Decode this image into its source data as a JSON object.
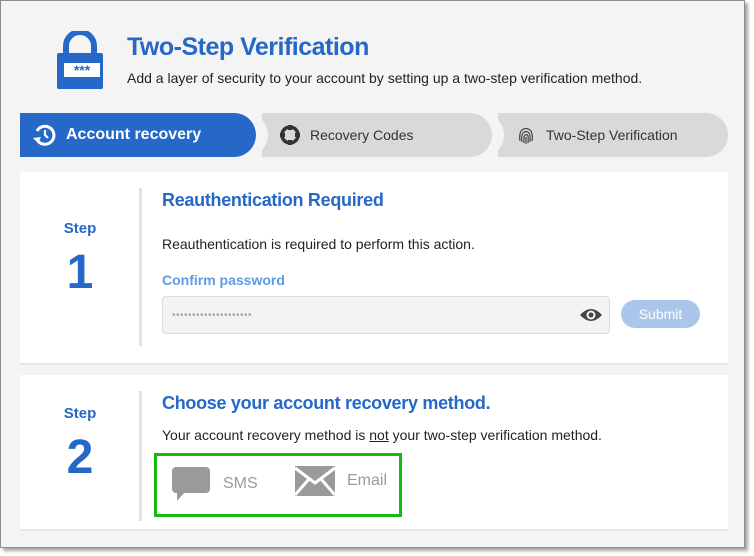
{
  "header": {
    "title": "Two-Step Verification",
    "subtitle": "Add a layer of security to your account by setting up a two-step verification method.",
    "icon": "lock-password-icon"
  },
  "tabs": [
    {
      "label": "Account recovery",
      "icon": "history-icon",
      "active": true
    },
    {
      "label": "Recovery Codes",
      "icon": "lifebuoy-icon",
      "active": false
    },
    {
      "label": "Two-Step Verification",
      "icon": "fingerprint-icon",
      "active": false
    }
  ],
  "steps": [
    {
      "step_label": "Step",
      "number": "1",
      "title": "Reauthentication Required",
      "text": "Reauthentication is required to perform this action.",
      "field_label": "Confirm password",
      "password_value": "••••••••••••••••••••",
      "submit_label": "Submit"
    },
    {
      "step_label": "Step",
      "number": "2",
      "title": "Choose your account recovery method.",
      "text_before": "Your account recovery method is ",
      "text_emph": "not",
      "text_after": " your two-step verification method.",
      "methods": [
        {
          "label": "SMS",
          "icon": "chat-bubble-icon"
        },
        {
          "label": "Email",
          "icon": "envelope-icon"
        }
      ]
    }
  ],
  "colors": {
    "accent": "#2668c8",
    "highlight_border": "#11bb11",
    "submit_disabled": "#aac6ea"
  }
}
